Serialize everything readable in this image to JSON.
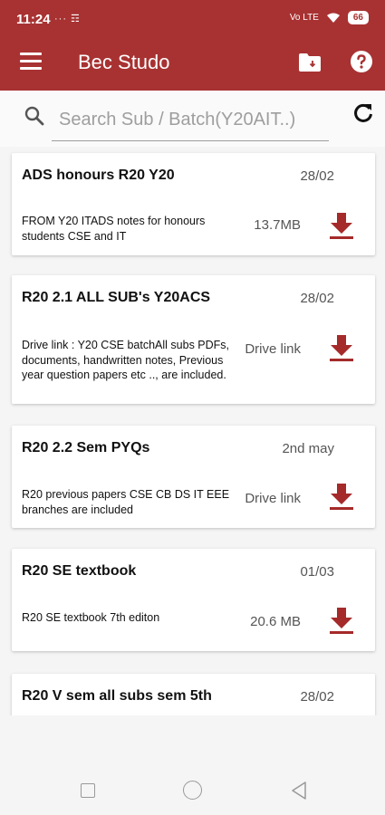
{
  "status_bar": {
    "time": "11:24",
    "left_indicators": "··· ☶",
    "right_label": "Vo LTE",
    "battery": "66"
  },
  "app_bar": {
    "title": "Bec Studo"
  },
  "search": {
    "placeholder": "Search Sub / Batch(Y20AIT..)",
    "value": ""
  },
  "items": [
    {
      "title": "ADS honours R20 Y20",
      "date": "28/02",
      "description": "FROM Y20 ITADS notes for honours students CSE and IT",
      "size": "13.7MB"
    },
    {
      "title": "R20 2.1 ALL SUB's  Y20ACS",
      "date": "28/02",
      "description": "Drive link : Y20 CSE batchAll subs PDFs, documents, handwritten notes, Previous year question papers etc .., are included.",
      "size": "Drive link"
    },
    {
      "title": "R20 2.2 Sem PYQs",
      "date": "2nd may",
      "description": "R20 previous papers CSE CB DS IT EEE branches are included",
      "size": "Drive link"
    },
    {
      "title": "R20 SE textbook",
      "date": "01/03",
      "description": "R20 SE textbook 7th editon",
      "size": "20.6 MB"
    },
    {
      "title": "R20 V sem all subs sem 5th",
      "date": "28/02",
      "description": "",
      "size": ""
    }
  ],
  "colors": {
    "primary": "#a83232",
    "download_icon": "#a52a2a"
  }
}
